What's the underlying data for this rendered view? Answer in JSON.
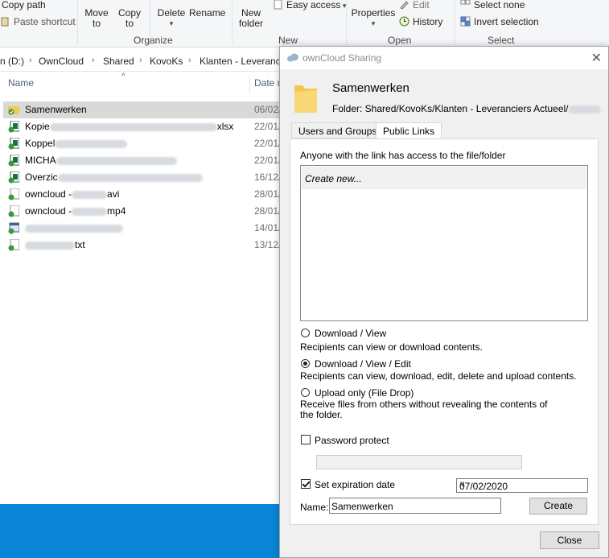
{
  "ribbon": {
    "copy_path": "Copy path",
    "paste_shortcut": "Paste shortcut",
    "move_to": "Move to",
    "copy_to": "Copy to",
    "delete": "Delete",
    "rename": "Rename",
    "new_folder": "New folder",
    "easy_access": "Easy access",
    "properties": "Properties",
    "edit": "Edit",
    "history": "History",
    "select_none": "Select none",
    "invert_selection": "Invert selection",
    "groups": {
      "organize": "Organize",
      "new": "New",
      "open": "Open",
      "select": "Select"
    }
  },
  "address": {
    "crumbs": [
      "n (D:)",
      "OwnCloud",
      "Shared",
      "KovoKs",
      "Klanten - Leveranci"
    ]
  },
  "files": {
    "col_name": "Name",
    "col_date": "Date m",
    "rows": [
      {
        "name": "Samenwerken",
        "date": "06/02/",
        "icon": "folder-sync-icon"
      },
      {
        "name": "Kopie",
        "suffix": "xlsx",
        "date": "22/01/",
        "icon": "excel-sync-icon"
      },
      {
        "name": "Koppel",
        "suffix": "",
        "date": "22/01/",
        "icon": "excel-sync-icon"
      },
      {
        "name": "MICHA",
        "suffix": "",
        "date": "22/01/",
        "icon": "excel-sync-icon"
      },
      {
        "name": "Overzic",
        "suffix": "",
        "date": "16/12/",
        "icon": "excel-sync-icon"
      },
      {
        "name": "owncloud -",
        "suffix": "avi",
        "date": "28/01/",
        "icon": "file-sync-icon"
      },
      {
        "name": "owncloud -",
        "suffix": "mp4",
        "date": "28/01/",
        "icon": "file-sync-icon"
      },
      {
        "name": "",
        "suffix": "",
        "date": "14/01/",
        "icon": "app-sync-icon"
      },
      {
        "name": "",
        "suffix": "txt",
        "date": "13/12/",
        "icon": "file-sync-icon"
      }
    ]
  },
  "dialog": {
    "title": "ownCloud Sharing",
    "folder_name": "Samenwerken",
    "folder_path": "Folder: Shared/KovoKs/Klanten - Leveranciers Actueel/",
    "tabs": [
      "Users and Groups",
      "Public Links"
    ],
    "info": "Anyone with the link has access to the file/folder",
    "create_new": "Create new...",
    "options": [
      {
        "label": "Download / View",
        "desc": "Recipients can view or download contents.",
        "selected": false
      },
      {
        "label": "Download / View / Edit",
        "desc": "Recipients can view, download, edit, delete and upload contents.",
        "selected": true
      },
      {
        "label": "Upload only (File Drop)",
        "desc": "Receive files from others without revealing the contents of the folder.",
        "selected": false
      }
    ],
    "password_label": "Password protect",
    "expiration_label": "Set expiration date",
    "expiration_date": "07/02/2020",
    "name_label": "Name:",
    "name_value": "Samenwerken",
    "create_button": "Create",
    "close_button": "Close"
  }
}
